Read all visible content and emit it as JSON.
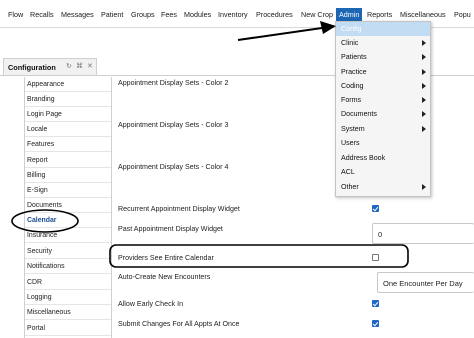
{
  "menubar": {
    "items": [
      "Flow",
      "Recalls",
      "Messages",
      "Patient",
      "Groups",
      "Fees",
      "Modules",
      "Inventory",
      "Procedures",
      "New Crop",
      "Admin",
      "Reports",
      "Miscellaneous",
      "Popu"
    ],
    "active": "Admin"
  },
  "tab": {
    "label": "Configuration",
    "refresh_icon": "refresh-icon",
    "close_icon": "close-icon"
  },
  "sidebar": {
    "items": [
      "Appearance",
      "Branding",
      "Login Page",
      "Locale",
      "Features",
      "Report",
      "Billing",
      "E-Sign",
      "Documents",
      "Calendar",
      "Insurance",
      "Security",
      "Notifications",
      "CDR",
      "Logging",
      "Miscellaneous",
      "Portal"
    ],
    "active": "Calendar"
  },
  "settings": [
    {
      "label": "Appointment Display Sets - Color 2"
    },
    {
      "label": "Appointment Display Sets - Color 3"
    },
    {
      "label": "Appointment Display Sets - Color 4"
    },
    {
      "label": "Recurrent Appointment Display Widget",
      "checked": true
    },
    {
      "label": "Past Appointment Display Widget",
      "value": "0"
    },
    {
      "label": "Providers See Entire Calendar",
      "checked": false
    },
    {
      "label": "Auto-Create New Encounters",
      "value": "One Encounter Per Day"
    },
    {
      "label": "Allow Early Check In",
      "checked": true
    },
    {
      "label": "Submit Changes For All Appts At Once",
      "checked": true
    }
  ],
  "admin_menu": {
    "items": [
      {
        "label": "Config",
        "submenu": false
      },
      {
        "label": "Clinic",
        "submenu": true
      },
      {
        "label": "Patients",
        "submenu": true
      },
      {
        "label": "Practice",
        "submenu": true
      },
      {
        "label": "Coding",
        "submenu": true
      },
      {
        "label": "Forms",
        "submenu": true
      },
      {
        "label": "Documents",
        "submenu": true
      },
      {
        "label": "System",
        "submenu": true
      },
      {
        "label": "Users",
        "submenu": false
      },
      {
        "label": "Address Book",
        "submenu": false
      },
      {
        "label": "ACL",
        "submenu": false
      },
      {
        "label": "Other",
        "submenu": true
      }
    ],
    "highlighted": "Config"
  },
  "colors": {
    "accent": "#1c66b4",
    "checkbox": "#1f66c9",
    "menu_bg": "#f5f5f5",
    "highlight": "#c2dcf4"
  },
  "annotations": {
    "arrow_icon": "arrow-annotation",
    "circle_icon": "circle-annotation",
    "box_icon": "highlight-box-annotation"
  }
}
